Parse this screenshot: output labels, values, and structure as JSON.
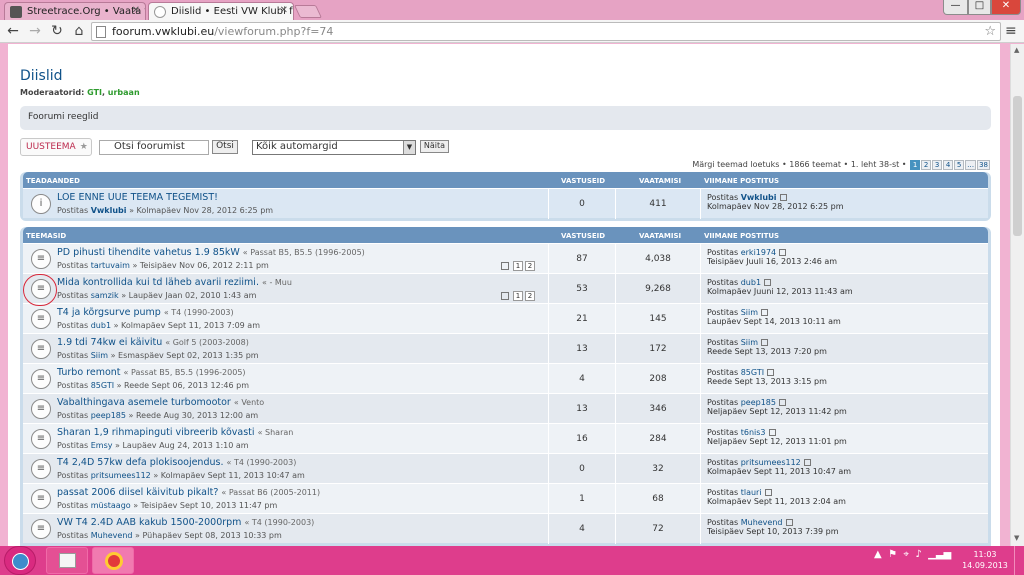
{
  "browser": {
    "tabs": [
      {
        "title": "Streetrace.Org • Vaata tee..."
      },
      {
        "title": "Diislid • Eesti VW Klubi fo..."
      }
    ],
    "window_controls": {
      "minimize": "—",
      "maximize": "□",
      "close": "✕"
    },
    "address": {
      "host": "foorum.vwklubi.eu",
      "path": "/viewforum.php?f=74"
    }
  },
  "forum": {
    "title": "Diislid",
    "moderators_label": "Moderaatorid:",
    "moderators": [
      "GTI",
      "urbaan"
    ],
    "rules": "Foorumi reeglid",
    "new_topic": "UUSTEEMA",
    "search_placeholder": "Otsi foorumist",
    "search_button": "Otsi",
    "make_select": "Kõik automargid",
    "show_button": "Näita",
    "mark_read": "Märgi teemad loetuks",
    "topic_count": "1866 teemat",
    "page_info": "1. leht 38-st",
    "pages": [
      "1",
      "2",
      "3",
      "4",
      "5",
      "…",
      "38"
    ]
  },
  "headers": {
    "announcements": "TEADAANDED",
    "topics": "TEEMASID",
    "replies": "VASTUSEID",
    "views": "VAATAMISI",
    "last_post": "VIIMANE POSTITUS"
  },
  "announcements": [
    {
      "title": "LOE ENNE UUE TEEMA TEGEMIST!",
      "category": "",
      "author_prefix": "Postitas",
      "author": "Vwklubi",
      "date": "» Kolmapäev Nov 28, 2012 6:25 pm",
      "replies": "0",
      "views": "411",
      "last_by": "Vwklubi",
      "last_date": "Kolmapäev Nov 28, 2012 6:25 pm"
    }
  ],
  "topics": [
    {
      "title": "PD pihusti tihendite vahetus 1.9 85kW",
      "category": "« Passat B5, B5.5 (1996-2005)",
      "author": "tartuvaim",
      "date": "» Teisipäev Nov 06, 2012 2:11 pm",
      "minipages": [
        "1",
        "2"
      ],
      "replies": "87",
      "views": "4,038",
      "last_by": "erki1974",
      "last_date": "Teisipäev Juuli 16, 2013 2:46 am"
    },
    {
      "title": "Mida kontrollida kui td läheb avarii reziimi.",
      "category": "« - Muu",
      "author": "samzik",
      "date": "» Laupäev Jaan 02, 2010 1:43 am",
      "minipages": [
        "1",
        "2"
      ],
      "replies": "53",
      "views": "9,268",
      "last_by": "dub1",
      "last_date": "Kolmapäev Juuni 12, 2013 11:43 am"
    },
    {
      "title": "T4 ja kõrgsurve pump",
      "category": "« T4 (1990-2003)",
      "author": "dub1",
      "date": "» Kolmapäev Sept 11, 2013 7:09 am",
      "minipages": [],
      "replies": "21",
      "views": "145",
      "last_by": "Siim",
      "last_date": "Laupäev Sept 14, 2013 10:11 am"
    },
    {
      "title": "1.9 tdi 74kw ei käivitu",
      "category": "« Golf 5 (2003-2008)",
      "author": "Siim",
      "date": "» Esmaspäev Sept 02, 2013 1:35 pm",
      "minipages": [],
      "replies": "13",
      "views": "172",
      "last_by": "Siim",
      "last_date": "Reede Sept 13, 2013 7:20 pm"
    },
    {
      "title": "Turbo remont",
      "category": "« Passat B5, B5.5 (1996-2005)",
      "author": "85GTI",
      "date": "» Reede Sept 06, 2013 12:46 pm",
      "minipages": [],
      "replies": "4",
      "views": "208",
      "last_by": "85GTI",
      "last_date": "Reede Sept 13, 2013 3:15 pm"
    },
    {
      "title": "Vabalthingava asemele turbomootor",
      "category": "« Vento",
      "author": "peep185",
      "date": "» Reede Aug 30, 2013 12:00 am",
      "minipages": [],
      "replies": "13",
      "views": "346",
      "last_by": "peep185",
      "last_date": "Neljapäev Sept 12, 2013 11:42 pm"
    },
    {
      "title": "Sharan 1,9 rihmapinguti vibreerib kõvasti",
      "category": "« Sharan",
      "author": "Emsy",
      "date": "» Laupäev Aug 24, 2013 1:10 am",
      "minipages": [],
      "replies": "16",
      "views": "284",
      "last_by": "t6nis3",
      "last_date": "Neljapäev Sept 12, 2013 11:01 pm"
    },
    {
      "title": "T4 2,4D 57kw defa plokisoojendus.",
      "category": "« T4 (1990-2003)",
      "author": "pritsumees112",
      "date": "» Kolmapäev Sept 11, 2013 10:47 am",
      "minipages": [],
      "replies": "0",
      "views": "32",
      "last_by": "pritsumees112",
      "last_date": "Kolmapäev Sept 11, 2013 10:47 am"
    },
    {
      "title": "passat 2006 diisel käivitub pikalt?",
      "category": "« Passat B6 (2005-2011)",
      "author": "müstaago",
      "date": "» Teisipäev Sept 10, 2013 11:47 pm",
      "minipages": [],
      "replies": "1",
      "views": "68",
      "last_by": "tlauri",
      "last_date": "Kolmapäev Sept 11, 2013 2:04 am"
    },
    {
      "title": "VW T4 2.4D AAB kakub 1500-2000rpm",
      "category": "« T4 (1990-2003)",
      "author": "Muhevend",
      "date": "» Pühapäev Sept 08, 2013 10:33 pm",
      "minipages": [],
      "replies": "4",
      "views": "72",
      "last_by": "Muhevend",
      "last_date": "Teisipäev Sept 10, 2013 7:39 pm"
    }
  ],
  "labels": {
    "posted_by": "Postitas"
  },
  "taskbar": {
    "time": "11:03",
    "date": "14.09.2013"
  }
}
